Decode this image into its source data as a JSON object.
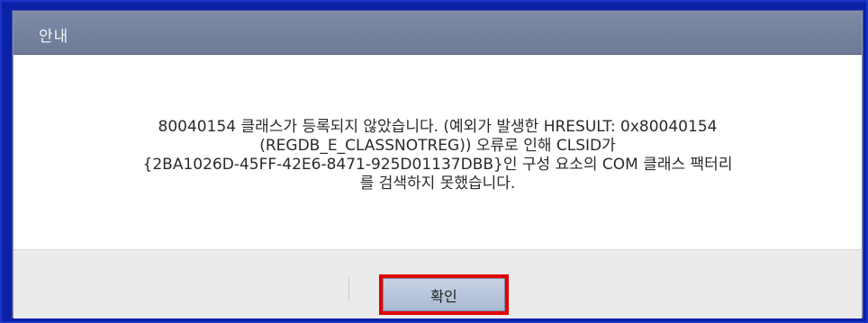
{
  "dialog": {
    "title": "안내",
    "message_lines": [
      "80040154 클래스가 등록되지 않았습니다. (예외가 발생한 HRESULT: 0x80040154",
      "(REGDB_E_CLASSNOTREG)) 오류로 인해 CLSID가",
      "{2BA1026D-45FF-42E6-8471-925D01137DBB}인 구성 요소의 COM 클래스 팩터리",
      "를 검색하지 못했습니다."
    ],
    "ok_label": "확인"
  },
  "colors": {
    "background_frame": "#0b22a8",
    "titlebar": "#7e8ba6",
    "footer": "#ebebeb",
    "highlight": "#e10000"
  }
}
